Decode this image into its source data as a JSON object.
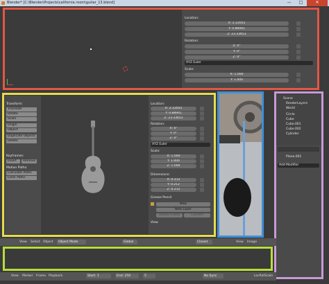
{
  "window": {
    "title": "Blender* [C:\\Blender\\Projects\\california room\\guitar_13.blend]",
    "min_glyph": "—",
    "max_glyph": "□",
    "close_glyph": "✕"
  },
  "top_properties": {
    "location_label": "Location:",
    "location": [
      "X: 2.12055",
      "Y: 0.88941",
      "Z: 23.33651"
    ],
    "rotation_label": "Rotation:",
    "rotation": [
      "X: 0°",
      "Y: 0°",
      "Z: 0°"
    ],
    "rotation_mode": "XYZ Euler",
    "scale_label": "Scale:",
    "scale": [
      "X: 1.000",
      "Y: 1.000"
    ]
  },
  "tool_shelf": {
    "transform_header": "Transform:",
    "transform_items": [
      "Translate",
      "Rotate",
      "Scale",
      "Origin",
      "Object",
      "Duplicate Objects",
      "Delete"
    ],
    "keyframes_header": "Keyframes:",
    "keyframe_items": [
      "Insert",
      "Remove"
    ],
    "motion_header": "Motion Paths:",
    "motion_items": [
      "Calculate Paths",
      "Clear Paths"
    ]
  },
  "mid_properties": {
    "location_label": "Location:",
    "location": [
      "X: 2.12055",
      "Y: 0.88941",
      "Z: 23.33651"
    ],
    "rotation_label": "Rotation:",
    "rotation": [
      "X: 0°",
      "Y: 0°",
      "Z: 0°"
    ],
    "rotation_mode": "XYZ Euler",
    "scale_label": "Scale:",
    "scale": [
      "X: 1.000",
      "Y: 1.000",
      "Z: 1.000"
    ],
    "dimensions_label": "Dimensions:",
    "dimensions": [
      "X: 0.212",
      "Y: 0.212",
      "Z: 0.212"
    ],
    "grease_header": "Grease Pencil",
    "grease_new": "New",
    "new_layer": "New Layer",
    "delete_frame": "Delete Frame",
    "convert": "Convert",
    "view_header": "View"
  },
  "outliner": {
    "scene": "Scene",
    "items": [
      "RenderLayers",
      "World",
      "Circle",
      "Cube",
      "Cube.001",
      "Cube.002",
      "Cylinder"
    ]
  },
  "properties_right": {
    "object_name": "Plane.001",
    "add_modifier": "Add Modifier"
  },
  "view3d_header": {
    "menus": [
      "View",
      "Select",
      "Object"
    ],
    "mode": "Object Mode",
    "orientation": "Global",
    "layer": "Closed"
  },
  "image_header": {
    "menus": [
      "View",
      "Image"
    ]
  },
  "timeline_footer": {
    "menus": [
      "View",
      "Marker",
      "Frame",
      "Playback"
    ],
    "start": "Start: 1",
    "end": "End: 250",
    "current": "5",
    "sync": "No Sync",
    "keying": "LocRotScale"
  },
  "colors": {
    "frame_red": "#e25745",
    "frame_yellow": "#e6dc4c",
    "frame_blue": "#3f8fd8",
    "frame_purple": "#c99ad8",
    "frame_green": "#b8de3a"
  }
}
